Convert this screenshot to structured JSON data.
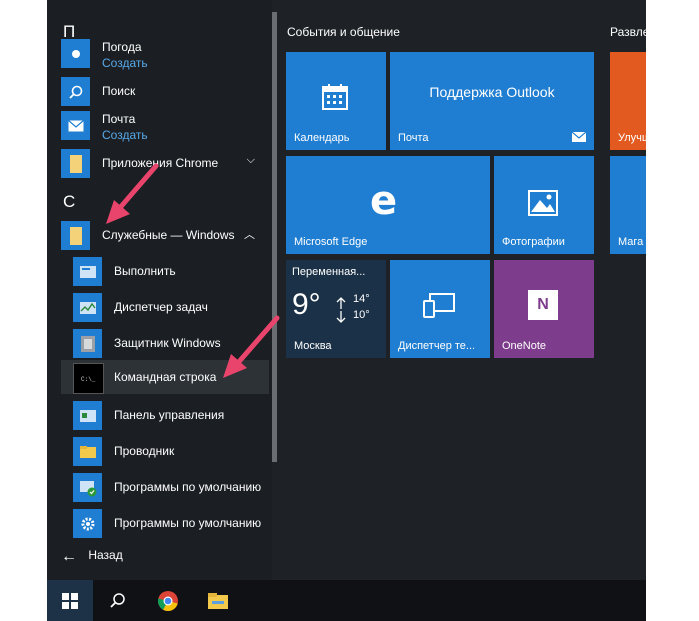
{
  "colors": {
    "accent": "#1f7ed2",
    "bg": "#1e2226",
    "tile_blue": "#1f7ed2",
    "onenote": "#7d3d8c",
    "orange": "#e35a21",
    "arrow": "#e9446b"
  },
  "applist": {
    "letter_p": "П",
    "letter_s": "С",
    "pogoda": {
      "label": "Погода",
      "action": "Создать"
    },
    "poisk": {
      "label": "Поиск"
    },
    "pochta": {
      "label": "Почта",
      "action": "Создать"
    },
    "chrome_apps": {
      "label": "Приложения Chrome",
      "chevron": "⌵"
    },
    "windows_tools": {
      "label": "Служебные — Windows",
      "chevron": "︿"
    },
    "subitems": [
      {
        "label": "Выполнить"
      },
      {
        "label": "Диспетчер задач"
      },
      {
        "label": "Защитник Windows"
      },
      {
        "label": "Командная строка"
      },
      {
        "label": "Панель управления"
      },
      {
        "label": "Проводник"
      },
      {
        "label": "Программы по умолчанию"
      },
      {
        "label": "Программы по умолчанию"
      }
    ],
    "back": "Назад"
  },
  "groups": {
    "events": "События и общение",
    "entertainment": "Развле"
  },
  "tiles": {
    "calendar": "Календарь",
    "outlook": "Поддержка Outlook",
    "mail": "Почта",
    "edge": "Microsoft Edge",
    "photos": "Фотографии",
    "weather_title": "Переменная...",
    "weather_temp": "9°",
    "weather_hi": "14°",
    "weather_lo": "10°",
    "weather_city": "Москва",
    "taskmgr": "Диспетчер те...",
    "onenote": "OneNote",
    "side1": "Улучш",
    "side2": "Мага"
  }
}
